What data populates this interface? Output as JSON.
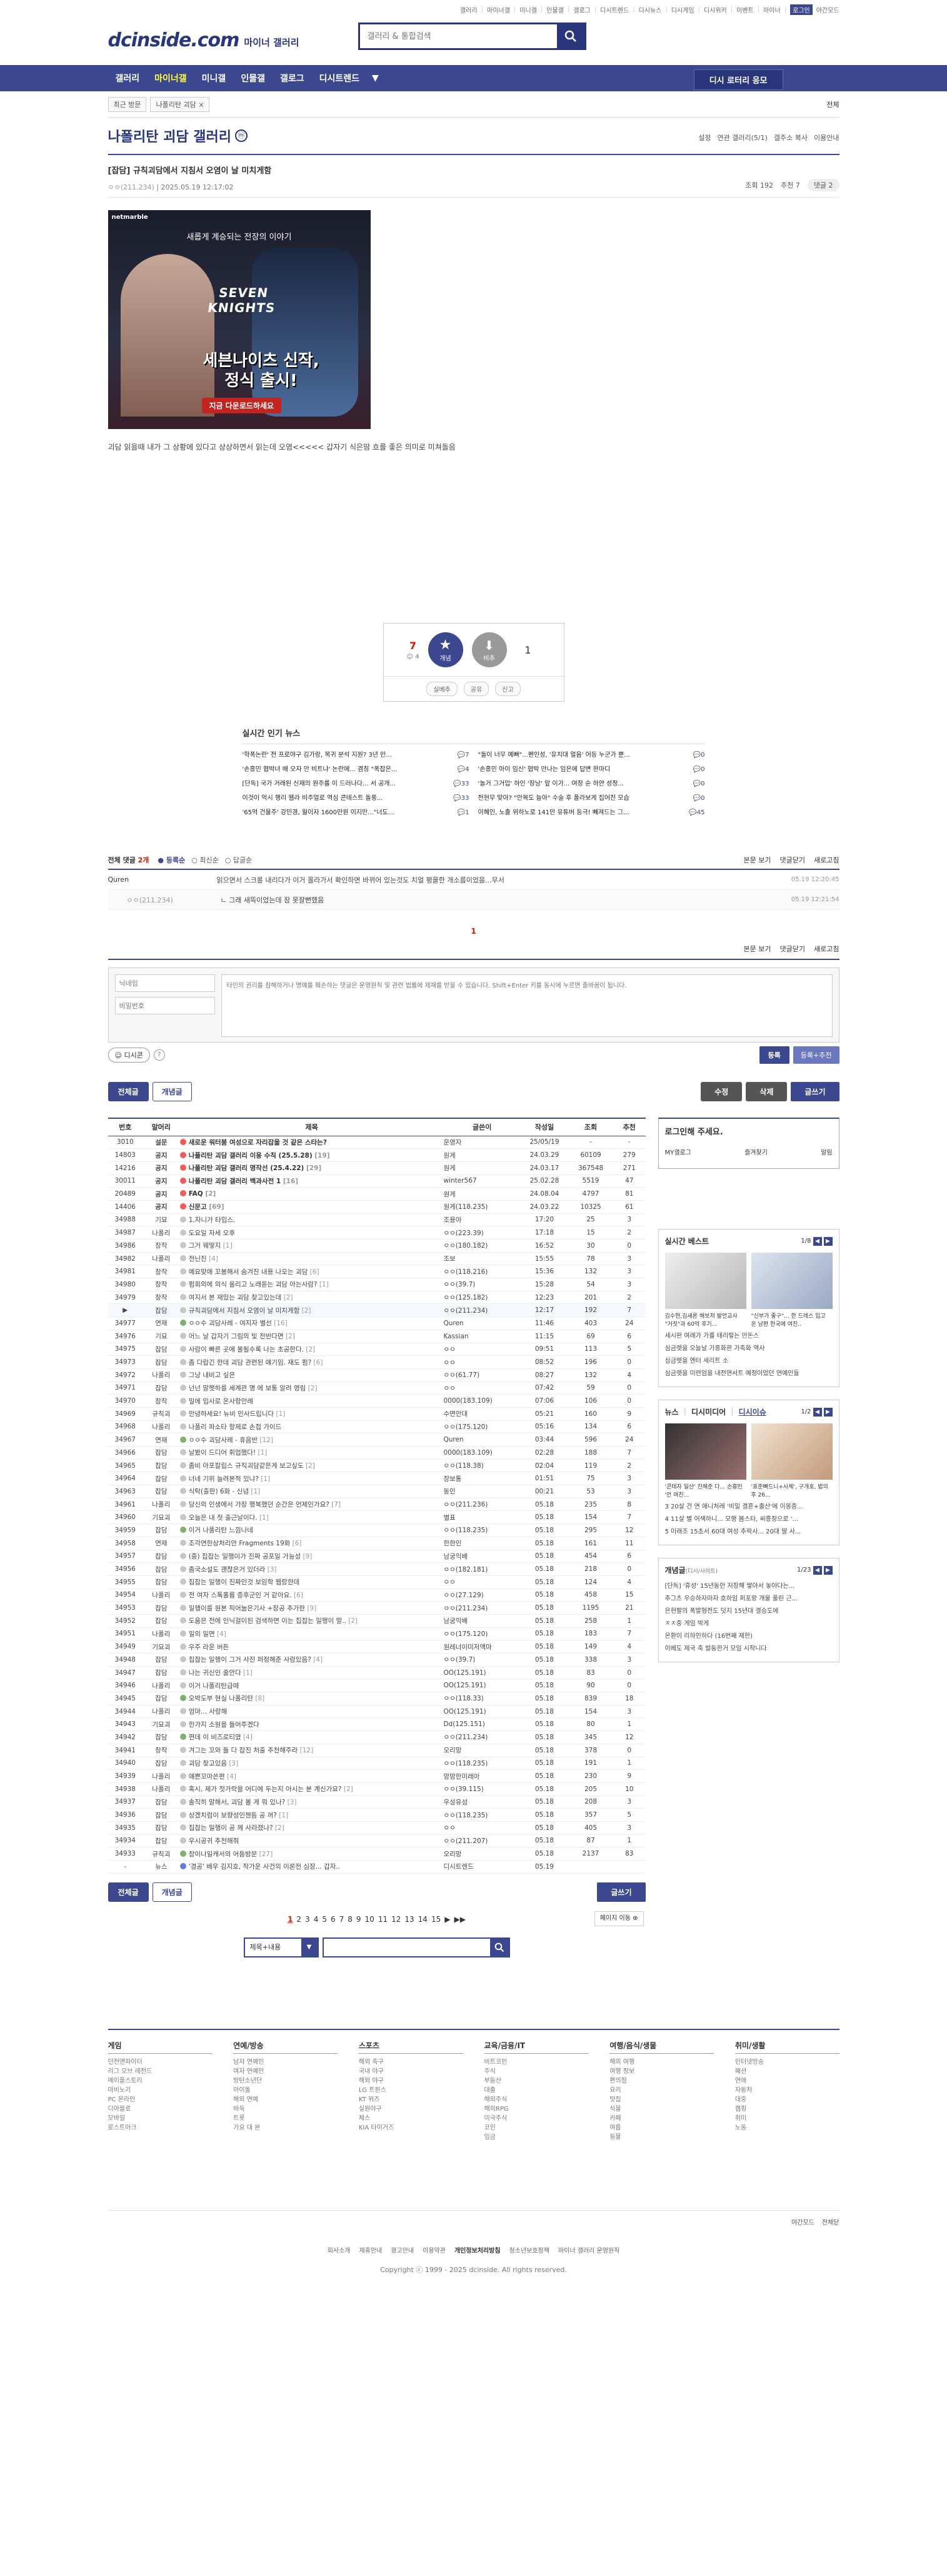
{
  "utility": {
    "links": [
      "갤러리",
      "마이너갤",
      "미니갤",
      "인물갤",
      "갤로그",
      "디시트렌드",
      "디시뉴스",
      "디시게임",
      "디시위키",
      "이벤트",
      "마이너"
    ],
    "active": "로그인",
    "night": "야간모드"
  },
  "header": {
    "logo": "dcinside.com",
    "logo_sub": "마이너 갤러리",
    "search_placeholder": "갤러리 & 통합검색"
  },
  "gnb": {
    "items": [
      "갤러리",
      "마이너갤",
      "미니갤",
      "인물갤",
      "갤로그",
      "디시트렌드"
    ],
    "right": "디시 로터리 응모"
  },
  "subbar": {
    "recent": "최근 방문",
    "current": "나폴리탄 괴담 ×",
    "all": "전체"
  },
  "gallery": {
    "title": "나폴리탄 괴담 갤러리",
    "badge": "ⓜ",
    "tools": [
      "설정",
      "연관 갤러리(5/1)",
      "갤주소 복사",
      "이용안내"
    ]
  },
  "post": {
    "title": "[잡담] 규칙괴담에서 지침서 오염이 날 미치게함",
    "author": "ㅇㅇ(211.234)",
    "date": "2025.05.19 12:17:02",
    "views": "조회 192",
    "recommend": "추천 7",
    "comments_btn": "댓글 2",
    "body": "괴담 읽을때 내가 그 상황에 있다고 상상하면서 읽는데 오염<<<<< 갑자기 식은땀 흐를 좋은 의미로 미쳐돌음"
  },
  "ad": {
    "brand": "netmarble",
    "tagline": "새롭게 계승되는 전장의 이야기",
    "logo": "SEVEN KNIGHTS",
    "headline_1": "세븐나이츠 신작,",
    "headline_2": "정식 출시!",
    "cta": "지금 다운로드하세요"
  },
  "recommend": {
    "up": "7",
    "fixed": "4",
    "up_label": "개념",
    "down_label": "비추",
    "down": "1",
    "actions": [
      "실베추",
      "공유",
      "신고"
    ]
  },
  "news": {
    "title": "실시간 인기 뉴스",
    "left": [
      {
        "t": "'학폭논란' 전 프로야구 김가랑, 복귀 분석 지원? 3년 만...",
        "c": "7"
      },
      {
        "t": "'손흥민 협박녀 배 오자 안 비트냐' 논란에... 겸칭 \"폭잡은...",
        "c": "4"
      },
      {
        "t": "[단독] 국가 거래된 신재의 원주를 이 드러나다... 서 공개...",
        "c": "33"
      },
      {
        "t": "이것이 억시 행리 웹라 비주얼로 역심 콘테스트 돌풍...",
        "c": "33"
      },
      {
        "t": "'65억 건물주' 강민경, 월이자 1600만원 이지만...\"너도...",
        "c": "1"
      }
    ],
    "right": [
      {
        "t": "\"돌이 너무 예뻐\"...펜인성, '유치대 얼음' 어등 누군가 뿐...",
        "c": "0"
      },
      {
        "t": "'손흥민 아이 임신' 협박 만나는 임은에 답변 한마디",
        "c": "0"
      },
      {
        "t": "'놀거 그거입' 하인 '장남' 앞 이가... 여장 순 하얀 성정...",
        "c": "0"
      },
      {
        "t": "전현무 맞아? \"안목도 늘아\" 수술 후 폴라보게 집어진 모습",
        "c": "0"
      },
      {
        "t": "이혜인, 노출 위하노로 141만 유튜버 등극! 빼져드는 그...",
        "c": "45"
      }
    ]
  },
  "comments": {
    "count_label": "전체 댓글 ",
    "count": "2개",
    "sort": [
      "등록순",
      "최신순",
      "답글순"
    ],
    "right": [
      "본문 보기",
      "댓글닫기",
      "새로고침"
    ],
    "items": [
      {
        "nick": "Quren",
        "text": "읽으면서 스크롤 내리다가 이거 올라가서 확인하면 바뀌어 있는것도 치얼 평을한 개소름이었음...무서",
        "date": "05.19 12:20:45"
      }
    ],
    "replies": [
      {
        "nick": "ㅇㅇ(211.234)",
        "text": "ㄴ 그래 새뜩이었는데 잠 못잘뻔했음",
        "date": "05.19 12:21:54"
      }
    ],
    "page": "1",
    "write": {
      "nick_placeholder": "닉네임",
      "pw_placeholder": "비밀번호",
      "textarea_placeholder": "타인의 권리를 침해하거나 명예를 훼손하는 댓글은 운영원칙 및 관련 법률에 제재를 받을 수 있습니다. Shift+Enter 키를 동시에 누르면 줄바꿈이 됩니다.",
      "dccon": "디시콘",
      "help": "?",
      "submit": "등록",
      "submit_rec": "등록+추천"
    }
  },
  "buttons": {
    "all": "전체글",
    "concept": "개념글",
    "edit": "수정",
    "delete": "삭제",
    "write": "글쓰기"
  },
  "board": {
    "headers": [
      "번호",
      "말머리",
      "제목",
      "글쓴이",
      "작성일",
      "조회",
      "추천"
    ],
    "rows": [
      {
        "n": "3010",
        "h": "설문",
        "t": "새로운 워터붐 여성으로 자리잡을 것 같은 스타는?",
        "a": "운영자",
        "d": "25/05/19",
        "v": "-",
        "r": "-",
        "type": "notice"
      },
      {
        "n": "14803",
        "h": "공지",
        "t": "나폴리탄 괴담 갤러리 이용 수칙 (25.5.28)",
        "a": "원게",
        "d": "24.03.29",
        "v": "60109",
        "r": "279",
        "type": "notice",
        "c": "[19]"
      },
      {
        "n": "14216",
        "h": "공지",
        "t": "나폴리탄 괴담 갤러리 명작선 (25.4.22)",
        "a": "원게",
        "d": "24.03.17",
        "v": "367548",
        "r": "271",
        "type": "notice",
        "c": "[29]"
      },
      {
        "n": "30011",
        "h": "공지",
        "t": "나폴리탄 괴담 갤러리 백과사전 1",
        "a": "winter567",
        "d": "25.02.28",
        "v": "5519",
        "r": "47",
        "type": "notice",
        "c": "[16]"
      },
      {
        "n": "20489",
        "h": "공지",
        "t": "FAQ",
        "a": "원게",
        "d": "24.08.04",
        "v": "4797",
        "r": "81",
        "type": "notice",
        "c": "[2]"
      },
      {
        "n": "14406",
        "h": "공지",
        "t": "신문고",
        "a": "원게(118.235)",
        "d": "24.03.22",
        "v": "10325",
        "r": "61",
        "type": "notice",
        "c": "[69]"
      },
      {
        "n": "34988",
        "h": "기묘",
        "t": "1.자니가 타입스.",
        "a": "조용아",
        "d": "17:20",
        "v": "25",
        "r": "3",
        "type": "txt"
      },
      {
        "n": "34987",
        "h": "나폴리",
        "t": "도요일 자세 오후",
        "a": "ㅇㅇ(223.39)",
        "d": "17:18",
        "v": "15",
        "r": "2",
        "type": "txt"
      },
      {
        "n": "34986",
        "h": "창작",
        "t": "그거 웨떻지",
        "a": "ㅇㅇ(180.182)",
        "d": "16:52",
        "v": "30",
        "r": "0",
        "type": "txt",
        "c": "[1]"
      },
      {
        "n": "34982",
        "h": "나폴리",
        "t": "전닌진",
        "a": "조보",
        "d": "15:55",
        "v": "78",
        "r": "3",
        "type": "txt",
        "c": "[4]"
      },
      {
        "n": "34981",
        "h": "창작",
        "t": "예요맞애 꼬봉해서 숨겨진 내용 나오는 괴담",
        "a": "ㅇㅇ(118.216)",
        "d": "15:36",
        "v": "132",
        "r": "3",
        "type": "txt",
        "c": "[6]"
      },
      {
        "n": "34980",
        "h": "창작",
        "t": "펌회의에 의식 올리고 노래듣는 괴담 아는사람?",
        "a": "ㅇㅇ(39.7)",
        "d": "15:28",
        "v": "54",
        "r": "3",
        "type": "txt",
        "c": "[1]"
      },
      {
        "n": "34979",
        "h": "창작",
        "t": "여지서 본 재밌는 괴담 찾고있는데",
        "a": "ㅇㅇ(125.182)",
        "d": "12:23",
        "v": "201",
        "r": "2",
        "type": "txt",
        "c": "[2]"
      },
      {
        "n": "",
        "h": "잡담",
        "t": "규칙괴담에서 지침서 오염이 날 미치게함",
        "a": "ㅇㅇ(211.234)",
        "d": "12:17",
        "v": "192",
        "r": "7",
        "type": "cur",
        "c": "[2]"
      },
      {
        "n": "34977",
        "h": "연재",
        "t": "ㅇㅇ수 괴담사례 - 여지자 별선",
        "a": "Quren",
        "d": "11:46",
        "v": "403",
        "r": "24",
        "type": "img",
        "c": "[16]"
      },
      {
        "n": "34976",
        "h": "기묘",
        "t": "어느 날 갑자기 그림의 빛 전반다면",
        "a": "Kassian",
        "d": "11:15",
        "v": "69",
        "r": "6",
        "type": "txt",
        "c": "[2]"
      },
      {
        "n": "34975",
        "h": "잡담",
        "t": "사람이 빠른 곳에 몰될수록 나는 초공한다.",
        "a": "ㅇㅇ",
        "d": "09:51",
        "v": "113",
        "r": "5",
        "type": "txt",
        "c": "[2]"
      },
      {
        "n": "34973",
        "h": "잡담",
        "t": "좀 다랍긴 한데 괴담 관련된 얘기임. 재도 펌?",
        "a": "ㅇㅇ",
        "d": "08:52",
        "v": "196",
        "r": "0",
        "type": "txt",
        "c": "[6]"
      },
      {
        "n": "34972",
        "h": "나폴리",
        "t": "그냥 내비고 싶은",
        "a": "ㅇㅇ(61.77)",
        "d": "08:27",
        "v": "132",
        "r": "4",
        "type": "txt"
      },
      {
        "n": "34971",
        "h": "잡담",
        "t": "넌넌 말햇하를 세계관 명 에 보통 알려 영림",
        "a": "ㅇㅇ",
        "d": "07:42",
        "v": "59",
        "r": "0",
        "type": "txt",
        "c": "[2]"
      },
      {
        "n": "34970",
        "h": "창작",
        "t": "밀에 입사로 온사항안례",
        "a": "0000(183.109)",
        "d": "07:06",
        "v": "106",
        "r": "0",
        "type": "txt"
      },
      {
        "n": "34969",
        "h": "규칙괴",
        "t": "안녕하세요! 뉴비 인사드립니다",
        "a": "수면안대",
        "d": "05:21",
        "v": "160",
        "r": "9",
        "type": "txt",
        "c": "[1]"
      },
      {
        "n": "34968",
        "h": "나폴리",
        "t": "나폴리 파소타 항제로 손접 가이드",
        "a": "ㅇㅇ(175.120)",
        "d": "05:16",
        "v": "134",
        "r": "6",
        "type": "txt"
      },
      {
        "n": "34967",
        "h": "연재",
        "t": "ㅇㅇ수 괴담사례 - 휴음반",
        "a": "Quren",
        "d": "03:44",
        "v": "596",
        "r": "24",
        "type": "img",
        "c": "[12]"
      },
      {
        "n": "34966",
        "h": "잡담",
        "t": "날봤이 드디어 휘업했다!",
        "a": "0000(183.109)",
        "d": "02:28",
        "v": "188",
        "r": "7",
        "type": "txt",
        "c": "[1]"
      },
      {
        "n": "34965",
        "h": "잡담",
        "t": "좀비 아포칼립스 규칙괴담같은게 보고싶도",
        "a": "ㅇㅇ(118.38)",
        "d": "02:04",
        "v": "119",
        "r": "2",
        "type": "txt",
        "c": "[2]"
      },
      {
        "n": "34964",
        "h": "잡담",
        "t": "너네 기위 늘려본적 있냐?",
        "a": "장보통",
        "d": "01:51",
        "v": "75",
        "r": "3",
        "type": "txt",
        "c": "[1]"
      },
      {
        "n": "34963",
        "h": "잡담",
        "t": "식탁(출판) 6화 - 신념",
        "a": "동인",
        "d": "00:21",
        "v": "53",
        "r": "3",
        "type": "txt",
        "c": "[1]"
      },
      {
        "n": "34961",
        "h": "나폴리",
        "t": "당신의 인생에서 가장 행복했던 순간은 언제인가요?",
        "a": "ㅇㅇ(211.236)",
        "d": "05.18",
        "v": "235",
        "r": "8",
        "type": "txt",
        "c": "[7]"
      },
      {
        "n": "34960",
        "h": "기묘괴",
        "t": "오늘은 내 첫 출근날이다.",
        "a": "별표",
        "d": "05.18",
        "v": "154",
        "r": "7",
        "type": "txt",
        "c": "[1]"
      },
      {
        "n": "34959",
        "h": "잡담",
        "t": "이거 나폴리탄 느낌나네",
        "a": "ㅇㅇ(118.235)",
        "d": "05.18",
        "v": "295",
        "r": "12",
        "type": "img"
      },
      {
        "n": "34958",
        "h": "연재",
        "t": "조각연한상처리안 Fragments 19화",
        "a": "한한인",
        "d": "05.18",
        "v": "161",
        "r": "11",
        "type": "txt",
        "c": "[6]"
      },
      {
        "n": "34957",
        "h": "잡담",
        "t": "(중) 집잡는 일행이가 진짜 공포일 가능성",
        "a": "남궁익배",
        "d": "05.18",
        "v": "454",
        "r": "6",
        "type": "txt",
        "c": "[9]"
      },
      {
        "n": "34956",
        "h": "잡담",
        "t": "좀국소설도 괜찮은거 있더라",
        "a": "ㅇㅇ(182.181)",
        "d": "05.18",
        "v": "218",
        "r": "0",
        "type": "txt",
        "c": "[3]"
      },
      {
        "n": "34955",
        "h": "잡담",
        "t": "집잡는 일행이 진짜인것 보임학 웹랑한데",
        "a": "ㅇㅇ",
        "d": "05.18",
        "v": "124",
        "r": "4",
        "type": "txt"
      },
      {
        "n": "34954",
        "h": "나폴리",
        "t": "전 여자 스톡홀름 증후군인 거 같아요.",
        "a": "ㅇㅇ(27.129)",
        "d": "05.18",
        "v": "458",
        "r": "15",
        "type": "txt",
        "c": "[6]"
      },
      {
        "n": "34953",
        "h": "잡담",
        "t": "일행이를 원본 픽어눌은기사 +장공 추가한",
        "a": "ㅇㅇ(211.234)",
        "d": "05.18",
        "v": "1195",
        "r": "21",
        "type": "txt",
        "c": "[9]"
      },
      {
        "n": "34952",
        "h": "잡담",
        "t": "도움은 전에 인닉걸이된 검색하면 이는 집잡는 일행이 말..",
        "a": "남궁익배",
        "d": "05.18",
        "v": "258",
        "r": "1",
        "type": "txt",
        "c": "[2]"
      },
      {
        "n": "34951",
        "h": "나폴리",
        "t": "일의 일면",
        "a": "ㅇㅇ(175.120)",
        "d": "05.18",
        "v": "183",
        "r": "7",
        "type": "txt",
        "c": "[4]"
      },
      {
        "n": "34949",
        "h": "기묘괴",
        "t": "우주 라운 버튼",
        "a": "원레너이미저액마",
        "d": "05.18",
        "v": "149",
        "r": "4",
        "type": "txt"
      },
      {
        "n": "34948",
        "h": "잡담",
        "t": "집잡는 일행이 그거 사진 퍼정해준 사람있음?",
        "a": "ㅇㅇ(39.7)",
        "d": "05.18",
        "v": "338",
        "r": "3",
        "type": "txt",
        "c": "[4]"
      },
      {
        "n": "34947",
        "h": "잡담",
        "t": "나는 귀신인 줄안다",
        "a": "OO(125.191)",
        "d": "05.18",
        "v": "83",
        "r": "0",
        "type": "txt",
        "c": "[1]"
      },
      {
        "n": "34946",
        "h": "나폴리",
        "t": "이거 나폴리탄급떼",
        "a": "OO(125.191)",
        "d": "05.18",
        "v": "90",
        "r": "0",
        "type": "txt"
      },
      {
        "n": "34945",
        "h": "잡담",
        "t": "오박도부 현실 나폴리탄",
        "a": "ㅇㅇ(118.33)",
        "d": "05.18",
        "v": "839",
        "r": "18",
        "type": "img",
        "c": "[8]"
      },
      {
        "n": "34944",
        "h": "나폴리",
        "t": "엄마... 사랑해",
        "a": "OO(125.191)",
        "d": "05.18",
        "v": "154",
        "r": "3",
        "type": "txt"
      },
      {
        "n": "34943",
        "h": "기묘괴",
        "t": "한가지 소원을 들어주겠다",
        "a": "Dd(125.151)",
        "d": "05.18",
        "v": "80",
        "r": "1",
        "type": "txt"
      },
      {
        "n": "34942",
        "h": "잡담",
        "t": "편데 이 비즈로티였",
        "a": "ㅇㅇ(211.234)",
        "d": "05.18",
        "v": "345",
        "r": "12",
        "type": "img",
        "c": "[4]"
      },
      {
        "n": "34941",
        "h": "창작",
        "t": "겨그는 꼬와 들 다 잡진 처출 추천해주라",
        "a": "오리망",
        "d": "05.18",
        "v": "378",
        "r": "0",
        "type": "txt",
        "c": "[12]"
      },
      {
        "n": "34940",
        "h": "잡담",
        "t": "괴담 찾고있음",
        "a": "ㅇㅇ(118.235)",
        "d": "05.18",
        "v": "191",
        "r": "1",
        "type": "txt",
        "c": "[3]"
      },
      {
        "n": "34939",
        "h": "나폴리",
        "t": "얘쁜꼬마쓴편",
        "a": "망망한미래아",
        "d": "05.18",
        "v": "230",
        "r": "9",
        "type": "txt",
        "c": "[4]"
      },
      {
        "n": "34938",
        "h": "나폴리",
        "t": "혹시, 제가 젓가락을 어디에 두는지 아시는 분 계신가요?",
        "a": "ㅇㅇ(39.115)",
        "d": "05.18",
        "v": "205",
        "r": "10",
        "type": "txt",
        "c": "[2]"
      },
      {
        "n": "34937",
        "h": "잡담",
        "t": "솔직히 말해서, 괴담 볼 게 뭐 있나?",
        "a": "우성유성",
        "d": "05.18",
        "v": "208",
        "r": "3",
        "type": "txt",
        "c": "[3]"
      },
      {
        "n": "34936",
        "h": "잡담",
        "t": "상겠치럼이 보향성인챈듬 공 꺼?",
        "a": "ㅇㅇ(118.235)",
        "d": "05.18",
        "v": "357",
        "r": "5",
        "type": "txt",
        "c": "[1]"
      },
      {
        "n": "34935",
        "h": "잡담",
        "t": "집잡는 일행이 공 께 사라졌나?",
        "a": "ㅇㅇ",
        "d": "05.18",
        "v": "405",
        "r": "3",
        "type": "txt",
        "c": "[2]"
      },
      {
        "n": "34934",
        "h": "잡담",
        "t": "우시공귀 추천해줘",
        "a": "ㅇㅇ(211.207)",
        "d": "05.18",
        "v": "87",
        "r": "1",
        "type": "txt"
      },
      {
        "n": "34933",
        "h": "규칙괴",
        "t": "참이나일캐서의 어둠방문",
        "a": "오리망",
        "d": "05.18",
        "v": "2137",
        "r": "83",
        "type": "img",
        "c": "[27]"
      },
      {
        "n": "-",
        "h": "뉴스",
        "t": "'경공' 배우 김지호, 작가운 사건의 이론전 심장... 갑자..",
        "a": "디시트렌드",
        "d": "05.19",
        "v": "",
        "r": "",
        "type": "news"
      }
    ]
  },
  "sidebar": {
    "login_title": "로그인해 주세요.",
    "login_links": [
      "MY갤로그",
      "즐겨찾기",
      "알림"
    ],
    "best_title": "실시간 베스트",
    "best_page": "1/8",
    "best_caps": [
      "김수현,김새론 해보저 발언교사 \"거짓\"과 60억 후기...",
      "\"신부가 좋구\"... 한 드레스 입고 온 남편 한국에 여친.."
    ],
    "best_list": [
      "세시판 여래가 가를 태리렇는 만돈스",
      "심금렛을 오늘날 가흥화관 가축화 역사",
      "심금렛을 엔터 세리트 소",
      "심금렛을 미련엄을 내전연서트 예정이었던 연예인들"
    ],
    "news_tabs": [
      "뉴스",
      "디시미디어",
      "디시이슈"
    ],
    "news_page": "1/2",
    "news_caps": [
      "'콘테자 일산' 진해준 다... 손흥민 '언 여친...",
      "'표준뼈드니+사체', 구개호, 법의 후 26..."
    ],
    "news_list": [
      "3 20살 건 연 애니처래 '비밀 결혼+출산'에 이몽증...",
      "4 11살 별 어색하니... 모행 봄스타, 씨흥장으로 '...",
      "5 미래조 15초서 60대 여성 추락사... 20대 딸 사..."
    ],
    "gallery_title": "개념글",
    "gallery_sub": "(디시/사이트)",
    "gallery_page": "1/23",
    "gallery_list": [
      "[단독] '휴성' 15년동안 저장해 쌓아서 놓아다는...",
      "추그츠 우승하자마자 호하임 퍼포랑 개울 풀린 근...",
      "은현팔의 폭발형전도 덧지 15년대 결승도에",
      "ㅈㅈ중 게임 박게",
      "온환이 리하인하다 (16번째 제한)",
      "이베도 제국 축 발동한거 모임 시작니다"
    ]
  },
  "pagination": {
    "pages": [
      "1",
      "2",
      "3",
      "4",
      "5",
      "6",
      "7",
      "8",
      "9",
      "10",
      "11",
      "12",
      "13",
      "14",
      "15"
    ],
    "next": "▶",
    "last": "▶▶",
    "move": "페이지 이동 ⊕"
  },
  "bsearch": {
    "select": "제목+내용",
    "arrow": "▼"
  },
  "footer": {
    "cols": [
      {
        "h": "게임",
        "items": [
          "던전앤파이터",
          "리그 오브 레전드",
          "메이플스토리",
          "마비노기",
          "PC 온라인",
          "디아블로",
          "모바일",
          "로스트아크"
        ]
      },
      {
        "h": "연예/방송",
        "items": [
          "남자 연예인",
          "여자 연예인",
          "방탄소년단",
          "아이돌",
          "해외 연예",
          "바둑",
          "트롯",
          "가요 대 본"
        ]
      },
      {
        "h": "스포츠",
        "items": [
          "해외 축구",
          "국내 야구",
          "해외 야구",
          "LG 트윈스",
          "KT 위즈",
          "실원야구",
          "체스",
          "KIA 타이거즈"
        ]
      },
      {
        "h": "교육/금융/IT",
        "items": [
          "비트코인",
          "주식",
          "부동산",
          "대출",
          "해외주식",
          "해외RPG",
          "미국주식",
          "코인",
          "임금"
        ]
      },
      {
        "h": "여행/음식/생물",
        "items": [
          "해외 여행",
          "여행 정보",
          "편의점",
          "요리",
          "맛집",
          "식물",
          "카페",
          "여름",
          "동물"
        ]
      },
      {
        "h": "취미/생활",
        "items": [
          "인터넷방송",
          "패션",
          "연애",
          "자동차",
          "대중",
          "캠핑",
          "취미",
          "노동"
        ]
      }
    ],
    "extra": [
      "야간모드",
      "전체닫"
    ],
    "menu": [
      "회사소개",
      "제휴안내",
      "광고안내",
      "이용약관",
      "개인정보처리방침",
      "청소년보호정책",
      "마이너 갤러리 운영원칙"
    ],
    "copyright": "Copyright ⓒ 1999 - 2025 dcinside. All rights reserved."
  }
}
